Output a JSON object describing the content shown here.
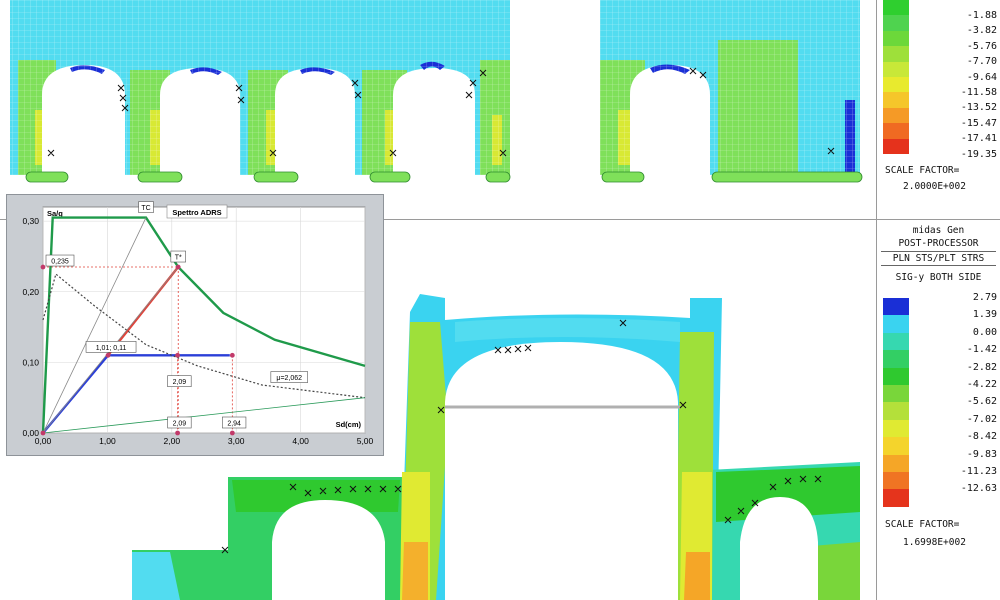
{
  "top_legend": {
    "values": [
      "-1.88",
      "-3.82",
      "-5.76",
      "-7.70",
      "-9.64",
      "-11.58",
      "-13.52",
      "-15.47",
      "-17.41",
      "-19.35"
    ],
    "colors": [
      "#2fcf2f",
      "#4fd34f",
      "#6cd83a",
      "#9ee03a",
      "#c8e838",
      "#e8ea2e",
      "#f5c62a",
      "#f59a26",
      "#f06a22",
      "#e5321c"
    ],
    "scale_factor_label": "SCALE FACTOR=",
    "scale_factor_value": "2.0000E+002"
  },
  "bottom_legend": {
    "app_name": "midas Gen",
    "module": "POST-PROCESSOR",
    "result_type": "PLN STS/PLT STRS",
    "component": "SIG-y BOTH SIDE",
    "values": [
      "2.79",
      "1.39",
      "0.00",
      "-1.42",
      "-2.82",
      "-4.22",
      "-5.62",
      "-7.02",
      "-8.42",
      "-9.83",
      "-11.23",
      "-12.63"
    ],
    "colors": [
      "#1a2fd6",
      "#3ad3f0",
      "#36d8b0",
      "#33cf64",
      "#2fc92f",
      "#79d63a",
      "#b4e03a",
      "#e0ea32",
      "#f4d42c",
      "#f5a627",
      "#f07423",
      "#e5341c"
    ],
    "scale_factor_label": "SCALE FACTOR=",
    "scale_factor_value": "1.6998E+002"
  },
  "chart_data": {
    "type": "line",
    "title": "Spettro ADRS",
    "xlabel": "Sd(cm)",
    "ylabel": "Sa/g",
    "xlim": [
      0,
      5
    ],
    "ylim": [
      0,
      0.32
    ],
    "x_ticks": [
      "0,00",
      "1,00",
      "2,00",
      "3,00",
      "4,00",
      "5,00"
    ],
    "y_ticks": [
      "0,00",
      "0,10",
      "0,20",
      "0,30"
    ],
    "series": [
      {
        "name": "",
        "color": "#1f9a4a",
        "points": [
          [
            0,
            0
          ],
          [
            0.15,
            0.305
          ],
          [
            1.6,
            0.305
          ],
          [
            2.1,
            0.235
          ],
          [
            2.8,
            0.17
          ],
          [
            3.6,
            0.132
          ],
          [
            5.0,
            0.095
          ]
        ]
      },
      {
        "name": "",
        "color": "#2b3fd8",
        "points": [
          [
            0,
            0
          ],
          [
            1.01,
            0.11
          ],
          [
            2.9,
            0.11
          ]
        ]
      },
      {
        "name": "",
        "color": "#e0433a",
        "points": [
          [
            1.01,
            0.11
          ],
          [
            2.1,
            0.235
          ]
        ]
      },
      {
        "name": "",
        "color": "#444444",
        "dashed": true,
        "points": [
          [
            0,
            0.16
          ],
          [
            0.2,
            0.225
          ],
          [
            0.8,
            0.18
          ],
          [
            1.6,
            0.125
          ],
          [
            2.4,
            0.095
          ],
          [
            3.4,
            0.068
          ],
          [
            5.0,
            0.05
          ]
        ]
      },
      {
        "name": "",
        "color": "#888888",
        "points": [
          [
            0,
            0
          ],
          [
            1.6,
            0.305
          ]
        ]
      },
      {
        "name": "",
        "color": "#888888",
        "points": [
          [
            0,
            0
          ],
          [
            2.1,
            0.235
          ]
        ]
      },
      {
        "name": "",
        "color": "#2a9a5a",
        "points": [
          [
            0,
            0
          ],
          [
            5.0,
            0.05
          ]
        ]
      }
    ],
    "annotations": [
      {
        "text": "TC",
        "x": 1.6,
        "y": 0.305
      },
      {
        "text": "0,235",
        "x": 0.0,
        "y": 0.235
      },
      {
        "text": "T*",
        "x": 2.1,
        "y": 0.235
      },
      {
        "text": "1,01; 0,11",
        "x": 1.01,
        "y": 0.11
      },
      {
        "text": "μ=2,062",
        "x": 3.6,
        "y": 0.07
      },
      {
        "text": "2,09",
        "x": 2.09,
        "y": 0.05
      },
      {
        "text": "2,09",
        "x": 2.09,
        "y": 0.0
      },
      {
        "text": "2,94",
        "x": 2.94,
        "y": 0.0
      }
    ]
  }
}
